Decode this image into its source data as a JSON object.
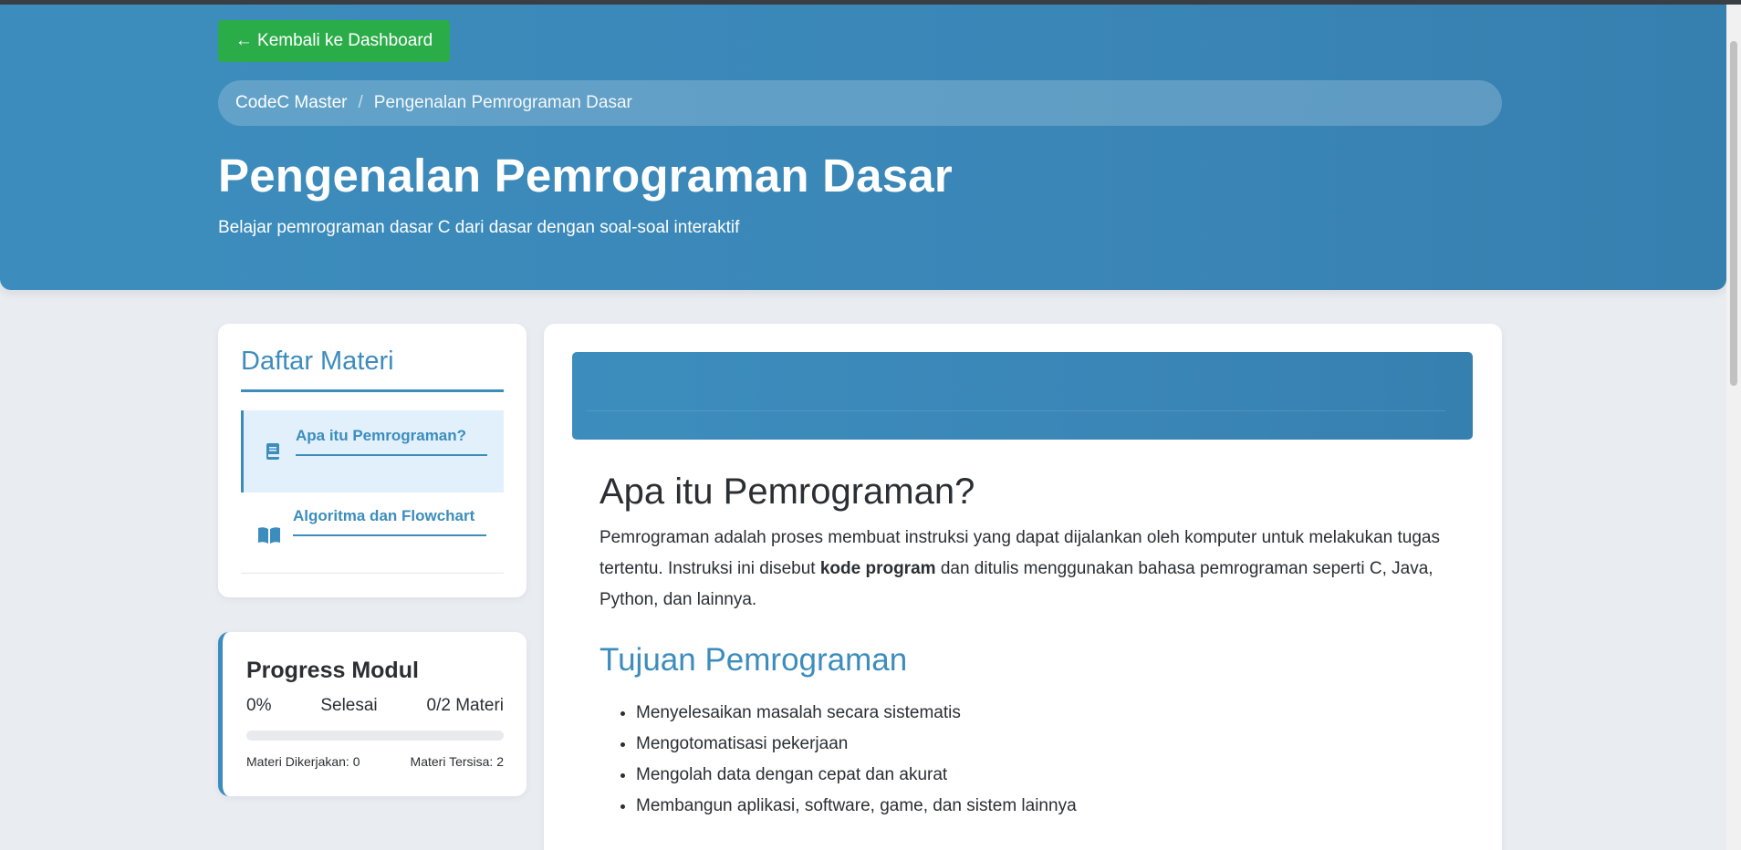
{
  "header": {
    "back_button": "← Kembali ke Dashboard",
    "breadcrumb": {
      "root": "CodeC Master",
      "separator": "/",
      "current": "Pengenalan Pemrograman Dasar"
    },
    "title": "Pengenalan Pemrograman Dasar",
    "subtitle": "Belajar pemrograman dasar C dari dasar dengan soal-soal interaktif"
  },
  "sidebar": {
    "title": "Daftar Materi",
    "items": [
      {
        "label": "Apa itu Pemrograman?",
        "icon": "book-icon",
        "active": true
      },
      {
        "label": "Algoritma dan Flowchart",
        "icon": "open-book-icon",
        "active": false
      }
    ]
  },
  "progress": {
    "title": "Progress Modul",
    "percent": "0%",
    "status": "Selesai",
    "count": "0/2 Materi",
    "fill": 0,
    "done": "Materi Dikerjakan: 0",
    "remaining": "Materi Tersisa: 2"
  },
  "content": {
    "heading": "Apa itu Pemrograman?",
    "paragraph": {
      "before": "Pemrograman adalah proses membuat instruksi yang dapat dijalankan oleh komputer untuk melakukan tugas tertentu. Instruksi ini disebut ",
      "bold": "kode program",
      "after": " dan ditulis menggunakan bahasa pemrograman seperti C, Java, Python, dan lainnya."
    },
    "subheading": "Tujuan Pemrograman",
    "goals": [
      "Menyelesaikan masalah secara sistematis",
      "Mengotomatisasi pekerjaan",
      "Mengolah data dengan cepat dan akurat",
      "Membangun aplikasi, software, game, dan sistem lainnya"
    ]
  },
  "colors": {
    "primary": "#3c8dbd",
    "success": "#2aad49",
    "background": "#e9edf2",
    "active_bg": "#e1f0fb"
  }
}
